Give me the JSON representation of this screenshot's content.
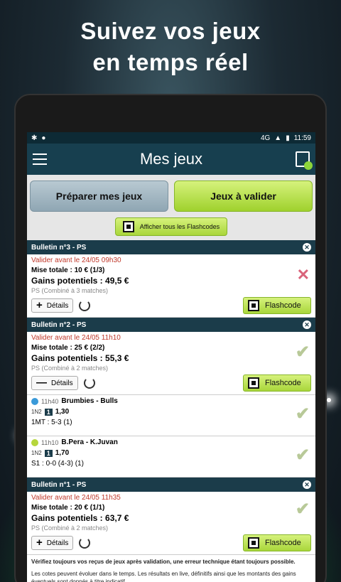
{
  "promo": {
    "line1": "Suivez vos jeux",
    "line2": "en temps réel"
  },
  "statusbar": {
    "time": "11:59",
    "network": "4G"
  },
  "app": {
    "title": "Mes jeux"
  },
  "tabs": {
    "prepare": "Préparer mes jeux",
    "validate": "Jeux à valider"
  },
  "flashcodes_all": "Afficher tous les Flashcodes",
  "bulletins": [
    {
      "header": "Bulletin n°3 - PS",
      "deadline": "Valider avant le 24/05 09h30",
      "stake": "Mise totale : 10 € (1/3)",
      "gains": "Gains potentiels : 49,5 €",
      "combo": "PS (Combiné à 3 matches)",
      "detail_label": "Détails",
      "detail_sign": "+",
      "flash_label": "Flashcode"
    },
    {
      "header": "Bulletin n°2 - PS",
      "deadline": "Valider avant le 24/05 11h10",
      "stake": "Mise totale : 25 € (2/2)",
      "gains": "Gains potentiels : 55,3 €",
      "combo": "PS (Combiné à 2 matches)",
      "detail_label": "Détails",
      "detail_sign": "—",
      "flash_label": "Flashcode"
    },
    {
      "header": "Bulletin n°1 - PS",
      "deadline": "Valider avant le 24/05 11h35",
      "stake": "Mise totale : 20 € (1/1)",
      "gains": "Gains potentiels : 63,7 €",
      "combo": "PS (Combiné à 2 matches)",
      "detail_label": "Détails",
      "detail_sign": "+",
      "flash_label": "Flashcode"
    }
  ],
  "matches": [
    {
      "time": "11h40",
      "teams": "Brumbies - Bulls",
      "bet_type": "1N2",
      "pick": "1",
      "odds": "1,30",
      "result": "1MT : 5-3 (1)"
    },
    {
      "time": "11h10",
      "teams": "B.Pera - K.Juvan",
      "bet_type": "1N2",
      "pick": "1",
      "odds": "1,70",
      "result": "S1 : 0-0 (4-3) (1)"
    }
  ],
  "notes": {
    "warning": "Vérifiez toujours vos reçus de jeux après validation, une erreur technique étant toujours possible.",
    "info": "Les cotes peuvent évoluer dans le temps. Les résultats en live, définitifs ainsi que les montants des gains éventuels sont donnés à titre indicatif."
  },
  "colors": {
    "accent_green": "#a9d63a",
    "header_blue": "#173f4f",
    "deadline_red": "#c0392b",
    "cancel_pink": "#d9637a",
    "ok_green": "#b8c998"
  }
}
